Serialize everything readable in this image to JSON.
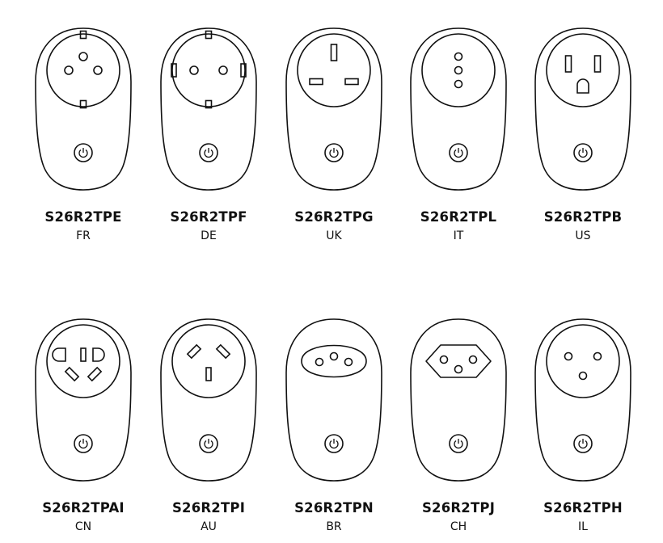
{
  "stroke_color": "#111111",
  "plugs": [
    {
      "model": "S26R2TPE",
      "region": "FR",
      "socket_icon": "type-e-socket-icon"
    },
    {
      "model": "S26R2TPF",
      "region": "DE",
      "socket_icon": "type-f-socket-icon"
    },
    {
      "model": "S26R2TPG",
      "region": "UK",
      "socket_icon": "type-g-socket-icon"
    },
    {
      "model": "S26R2TPL",
      "region": "IT",
      "socket_icon": "type-l-socket-icon"
    },
    {
      "model": "S26R2TPB",
      "region": "US",
      "socket_icon": "type-b-socket-icon"
    },
    {
      "model": "S26R2TPAI",
      "region": "CN",
      "socket_icon": "type-ai-socket-icon"
    },
    {
      "model": "S26R2TPI",
      "region": "AU",
      "socket_icon": "type-i-socket-icon"
    },
    {
      "model": "S26R2TPN",
      "region": "BR",
      "socket_icon": "type-n-socket-icon"
    },
    {
      "model": "S26R2TPJ",
      "region": "CH",
      "socket_icon": "type-j-socket-icon"
    },
    {
      "model": "S26R2TPH",
      "region": "IL",
      "socket_icon": "type-h-socket-icon"
    }
  ]
}
